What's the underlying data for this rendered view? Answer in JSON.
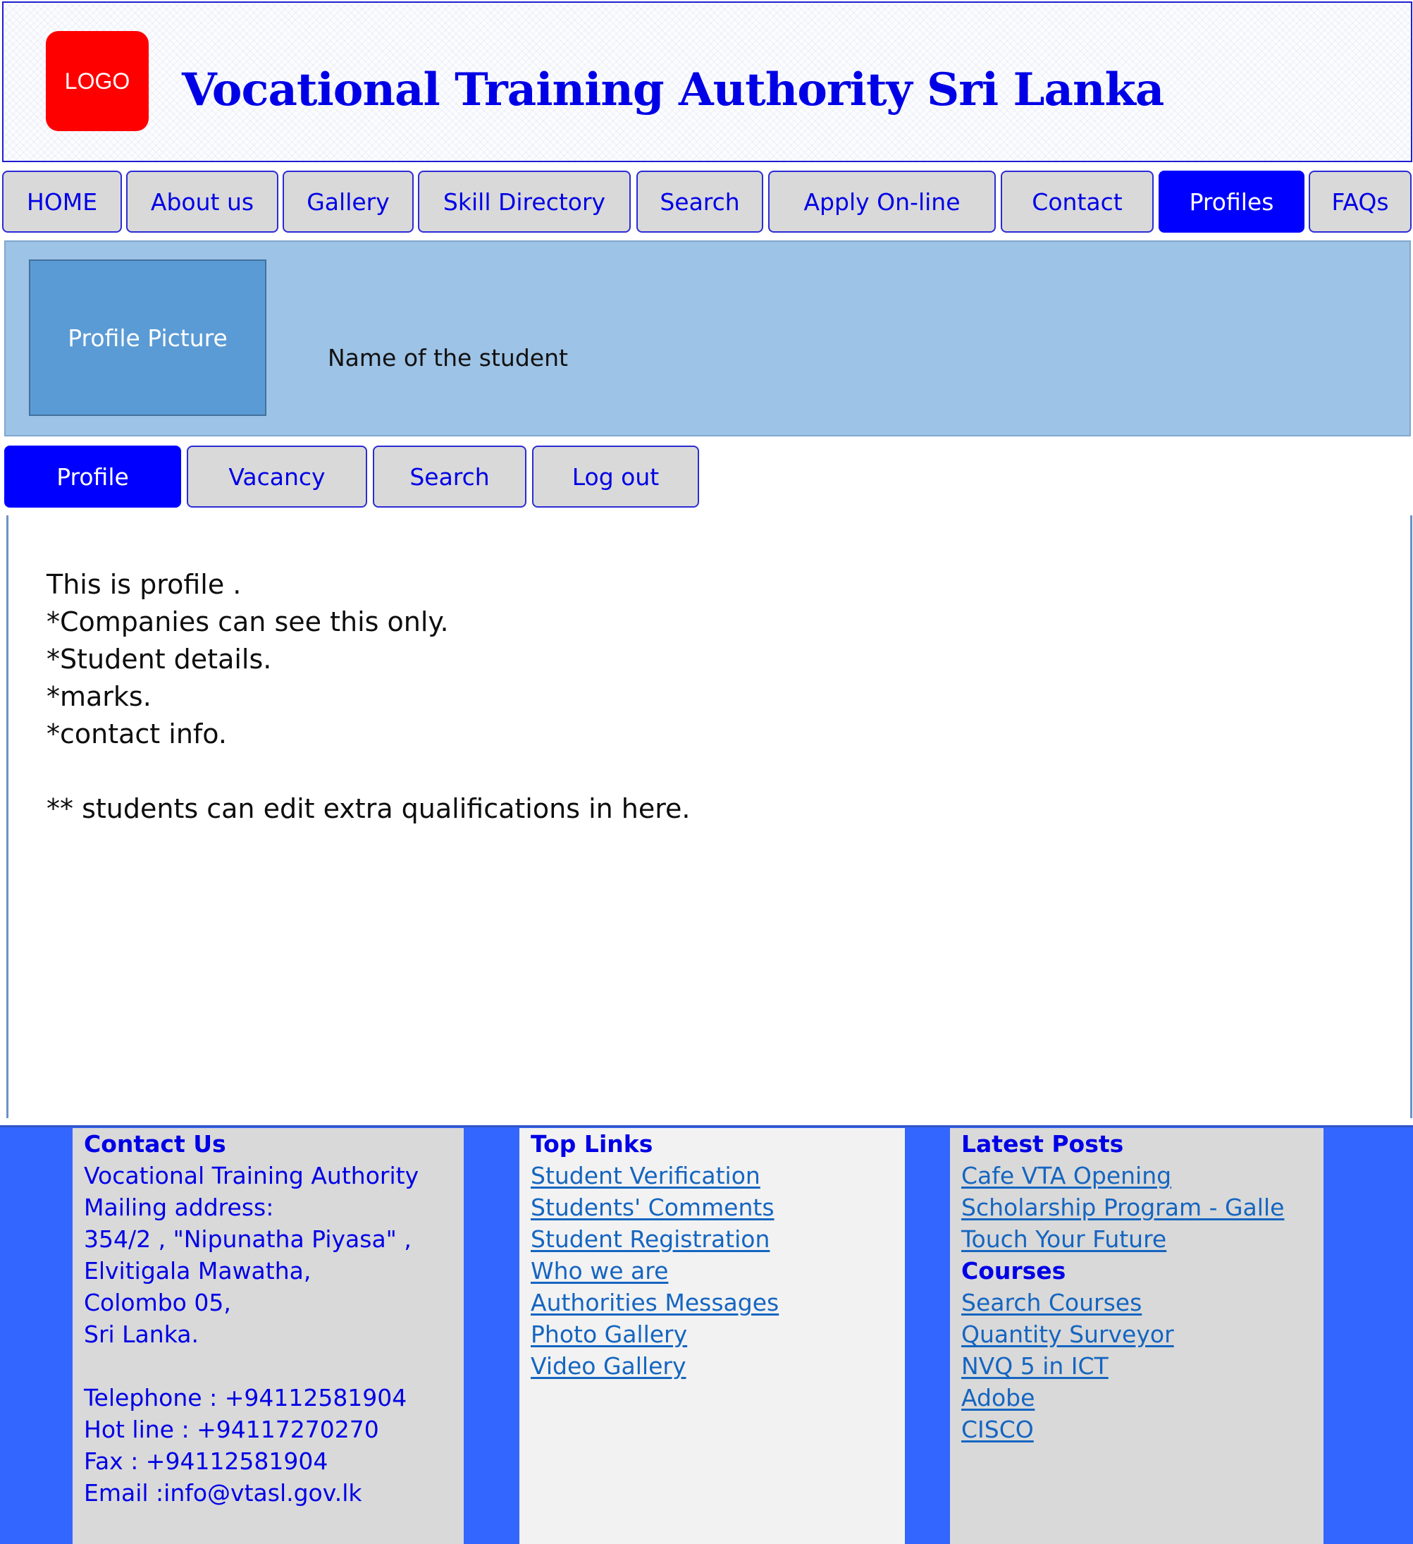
{
  "header": {
    "logo_text": "LOGO",
    "site_title": "Vocational Training Authority Sri Lanka"
  },
  "nav": {
    "items": [
      {
        "label": "HOME"
      },
      {
        "label": "About us"
      },
      {
        "label": "Gallery"
      },
      {
        "label": "Skill Directory"
      },
      {
        "label": "Search"
      },
      {
        "label": "Apply On-line"
      },
      {
        "label": "Contact"
      },
      {
        "label": "Profiles",
        "active": true
      },
      {
        "label": "FAQs"
      }
    ]
  },
  "profile": {
    "picture_label": "Profile Picture",
    "student_name": "Name of the student"
  },
  "subnav": {
    "items": [
      {
        "label": "Profile",
        "active": true
      },
      {
        "label": "Vacancy"
      },
      {
        "label": "Search"
      },
      {
        "label": "Log out"
      }
    ]
  },
  "content": {
    "lines": [
      "This is profile .",
      "*Companies can see this only.",
      "*Student details.",
      "*marks.",
      "*contact info.",
      "",
      "** students can edit extra qualifications in here."
    ]
  },
  "footer": {
    "contact": {
      "heading": "Contact Us",
      "org": "Vocational Training Authority",
      "mailing_label": "Mailing address:",
      "address": [
        "354/2 , \"Nipunatha Piyasa\" ,",
        "Elvitigala Mawatha,",
        "Colombo 05,",
        "Sri Lanka."
      ],
      "telephone": "Telephone : +94112581904",
      "hotline": "Hot line : +94117270270",
      "fax": "Fax : +94112581904",
      "email": "Email :info@vtasl.gov.lk"
    },
    "top_links": {
      "heading": "Top Links",
      "links": [
        "Student Verification",
        "Students' Comments",
        "Student Registration",
        "Who we are",
        "Authorities Messages",
        "Photo Gallery",
        "Video Gallery"
      ]
    },
    "latest_posts": {
      "heading": "Latest Posts",
      "posts": [
        "Cafe VTA Opening",
        "Scholarship Program - Galle",
        "Touch Your Future"
      ],
      "courses_heading": "Courses",
      "courses": [
        "Search Courses",
        "Quantity Surveyor",
        "NVQ 5 in ICT",
        "Adobe",
        "CISCO"
      ]
    }
  },
  "colors": {
    "brand_blue": "#0000ff",
    "tab_bg": "#d9d9d9",
    "banner_bg": "#9dc3e6",
    "footer_blue": "#3366ff",
    "logo_red": "#ff0000"
  }
}
